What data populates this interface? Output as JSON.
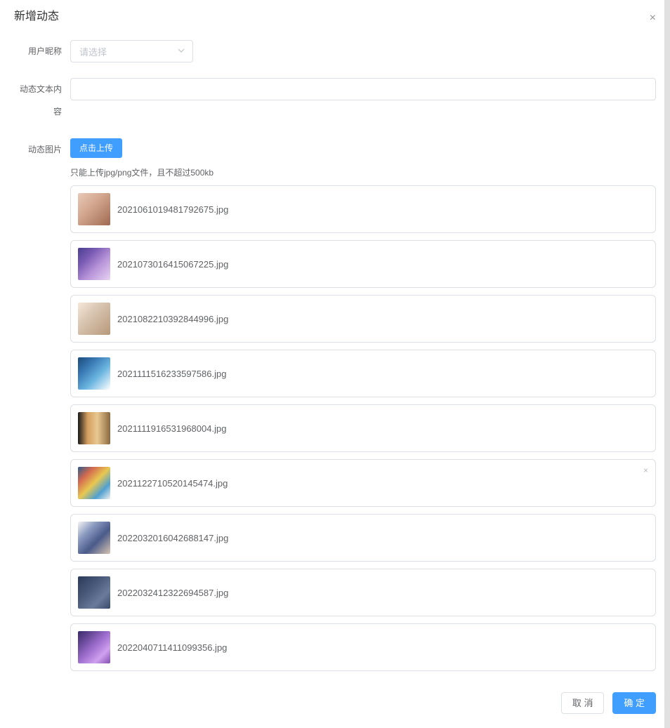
{
  "dialog": {
    "title": "新增动态",
    "close_icon": "×"
  },
  "form": {
    "nickname": {
      "label": "用户昵称",
      "placeholder": "请选择"
    },
    "content": {
      "label": "动态文本内容",
      "value": ""
    },
    "images": {
      "label": "动态图片",
      "upload_button": "点击上传",
      "tip": "只能上传jpg/png文件，且不超过500kb"
    }
  },
  "uploaded_files": [
    {
      "name": "2021061019481792675.jpg",
      "thumb": "thumb-1",
      "hovered": false
    },
    {
      "name": "2021073016415067225.jpg",
      "thumb": "thumb-2",
      "hovered": false
    },
    {
      "name": "2021082210392844996.jpg",
      "thumb": "thumb-3",
      "hovered": false
    },
    {
      "name": "2021111516233597586.jpg",
      "thumb": "thumb-4",
      "hovered": false
    },
    {
      "name": "2021111916531968004.jpg",
      "thumb": "thumb-5",
      "hovered": false
    },
    {
      "name": "2021122710520145474.jpg",
      "thumb": "thumb-6",
      "hovered": true
    },
    {
      "name": "2022032016042688147.jpg",
      "thumb": "thumb-7",
      "hovered": false
    },
    {
      "name": "2022032412322694587.jpg",
      "thumb": "thumb-8",
      "hovered": false
    },
    {
      "name": "2022040711411099356.jpg",
      "thumb": "thumb-9",
      "hovered": false
    }
  ],
  "footer": {
    "cancel": "取 消",
    "confirm": "确 定"
  }
}
